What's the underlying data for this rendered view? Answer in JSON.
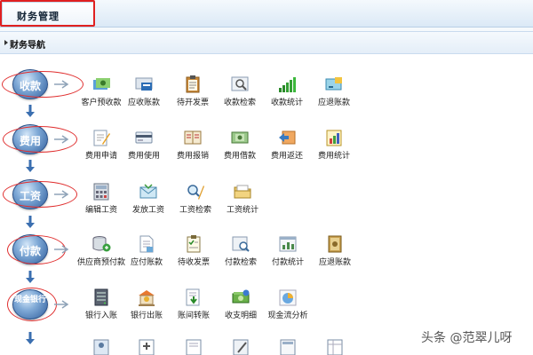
{
  "tab": {
    "label": "财务管理"
  },
  "section": {
    "title": "财务导航"
  },
  "rows": [
    {
      "category": "收款",
      "items": [
        "客户预收款",
        "应收账款",
        "待开发票",
        "收款检索",
        "收款统计",
        "应退账款"
      ]
    },
    {
      "category": "费用",
      "items": [
        "费用申请",
        "费用使用",
        "费用报销",
        "费用借款",
        "费用返还",
        "费用统计"
      ]
    },
    {
      "category": "工资",
      "items": [
        "编辑工资",
        "发放工资",
        "工资检索",
        "工资统计"
      ]
    },
    {
      "category": "付款",
      "items": [
        "供应商预付款",
        "应付账款",
        "待收发票",
        "付款检索",
        "付款统计",
        "应退账款"
      ]
    },
    {
      "category": "现金银行",
      "items": [
        "银行入账",
        "银行出账",
        "账间转账",
        "收支明细",
        "现金流分析"
      ]
    }
  ],
  "watermark": "头条 @范翠儿呀"
}
